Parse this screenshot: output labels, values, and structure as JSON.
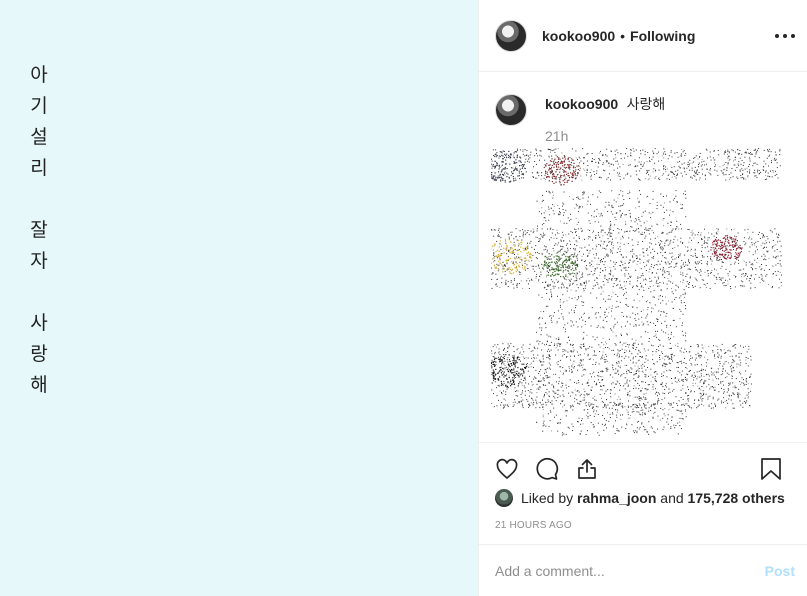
{
  "photo": {
    "background": "#e6f8fa",
    "lines": [
      "아",
      "기",
      "설",
      "리",
      "",
      "잘",
      "자",
      "",
      "사",
      "랑",
      "해"
    ]
  },
  "header": {
    "username": "kookoo900",
    "separator": "•",
    "follow_status": "Following"
  },
  "caption": {
    "username": "kookoo900",
    "text": "사랑해",
    "time": "21h"
  },
  "likes": {
    "prefix": "Liked by",
    "user": "rahma_joon",
    "middle": "and",
    "count": "175,728 others"
  },
  "timestamp": "21 HOURS AGO",
  "comment_input": {
    "placeholder": "Add a comment...",
    "post_label": "Post"
  },
  "icons": {
    "like": "heart-icon",
    "comment": "comment-icon",
    "share": "share-icon",
    "save": "bookmark-icon",
    "more": "more-options-icon"
  },
  "colors": {
    "link_disabled": "#b2dffc",
    "muted": "#8e8e8e",
    "text": "#262626"
  }
}
